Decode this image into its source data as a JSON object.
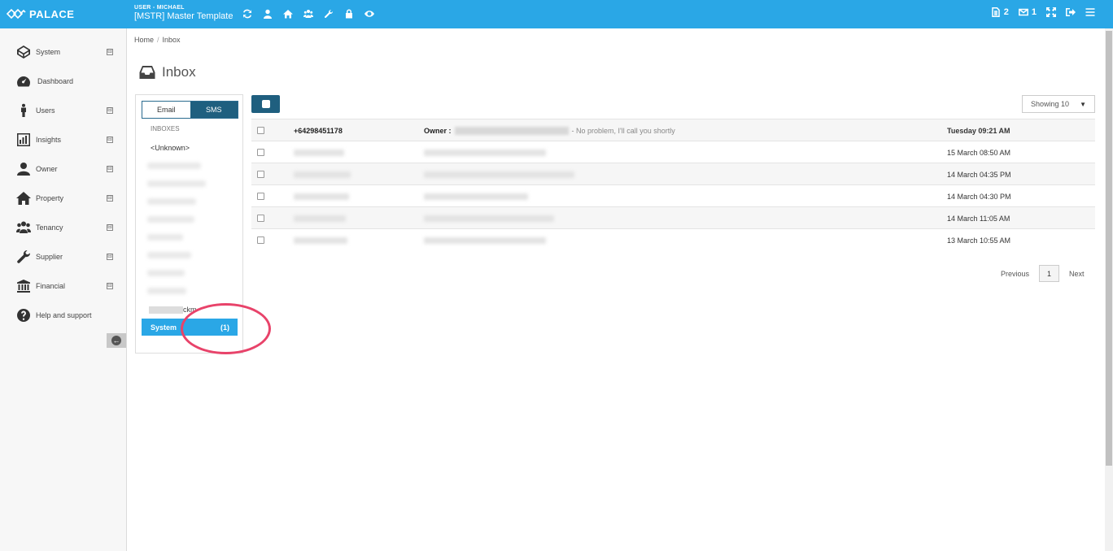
{
  "header": {
    "brand": "PALACE",
    "user_label": "USER - MICHAEL",
    "template_name": "[MSTR] Master Template",
    "doc_count": "2",
    "mail_count": "1"
  },
  "sidebar": {
    "items": [
      {
        "label": "System",
        "icon": "codepen-icon"
      },
      {
        "label": "Dashboard",
        "icon": "dashboard-icon"
      },
      {
        "label": "Users",
        "icon": "person-icon"
      },
      {
        "label": "Insights",
        "icon": "chart-icon"
      },
      {
        "label": "Owner",
        "icon": "user-icon"
      },
      {
        "label": "Property",
        "icon": "home-icon"
      },
      {
        "label": "Tenancy",
        "icon": "group-icon"
      },
      {
        "label": "Supplier",
        "icon": "wrench-icon"
      },
      {
        "label": "Financial",
        "icon": "bank-icon"
      },
      {
        "label": "Help and support",
        "icon": "question-icon"
      }
    ],
    "expand_symbol": "⊟"
  },
  "breadcrumb": {
    "home": "Home",
    "separator": "/",
    "current": "Inbox"
  },
  "page": {
    "title": "Inbox"
  },
  "inbox_panel": {
    "tab_email": "Email",
    "tab_sms": "SMS",
    "heading": "INBOXES",
    "unknown": "<Unknown>",
    "partial_suffix": "ckm",
    "system_label": "System",
    "system_count": "(1)"
  },
  "list_controls": {
    "showing": "Showing 10"
  },
  "messages": [
    {
      "number": "+64298451178",
      "from_label": "Owner :",
      "preview": "- No problem, I'll call you shortly",
      "date": "Tuesday 09:21 AM"
    },
    {
      "date": "15 March 08:50 AM"
    },
    {
      "date": "14 March 04:35 PM"
    },
    {
      "date": "14 March 04:30 PM"
    },
    {
      "date": "14 March 11:05 AM"
    },
    {
      "date": "13 March 10:55 AM"
    }
  ],
  "pager": {
    "previous": "Previous",
    "page": "1",
    "next": "Next"
  }
}
